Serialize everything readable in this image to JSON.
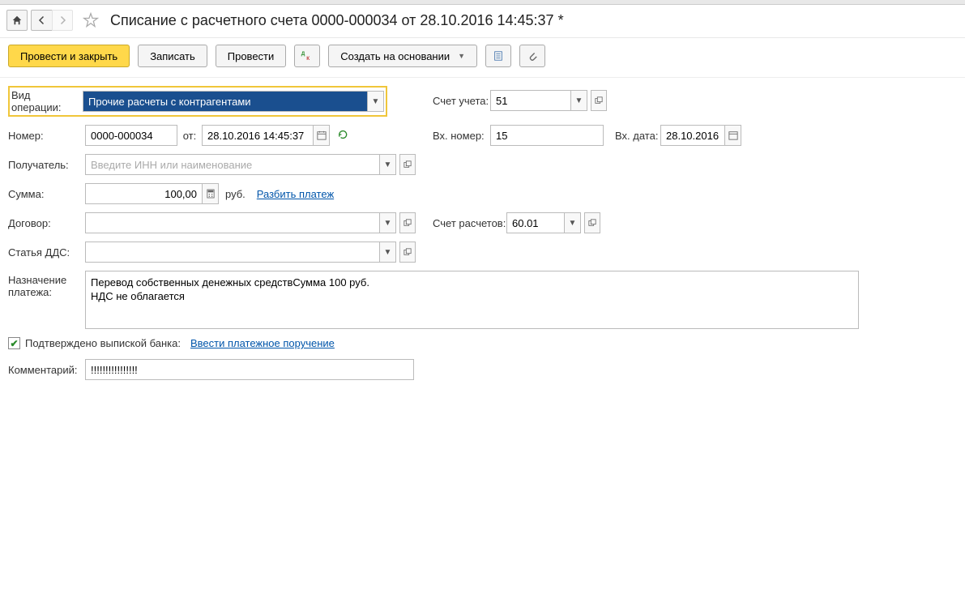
{
  "header": {
    "title": "Списание с расчетного счета 0000-000034 от 28.10.2016 14:45:37 *"
  },
  "toolbar": {
    "post_and_close": "Провести и закрыть",
    "save": "Записать",
    "post": "Провести",
    "create_based_on": "Создать на основании"
  },
  "labels": {
    "operation_type": "Вид операции:",
    "account": "Счет учета:",
    "number": "Номер:",
    "from": "от:",
    "incoming_number": "Вх. номер:",
    "incoming_date": "Вх. дата:",
    "recipient": "Получатель:",
    "amount": "Сумма:",
    "currency": "руб.",
    "split_payment": "Разбить платеж",
    "contract": "Договор:",
    "settlement_account": "Счет расчетов:",
    "dds_article": "Статья ДДС:",
    "purpose": "Назначение\nплатежа:",
    "confirmed": "Подтверждено выпиской банка:",
    "enter_payment_order": "Ввести платежное поручение",
    "comment": "Комментарий:"
  },
  "fields": {
    "operation_type": "Прочие расчеты с контрагентами",
    "account": "51",
    "number": "0000-000034",
    "date": "28.10.2016 14:45:37",
    "incoming_number": "15",
    "incoming_date": "28.10.2016",
    "recipient": "",
    "recipient_placeholder": "Введите ИНН или наименование",
    "amount": "100,00",
    "contract": "",
    "settlement_account": "60.01",
    "dds_article": "",
    "purpose": "Перевод собственных денежных средствСумма 100 руб.\nНДС не облагается",
    "confirmed": true,
    "comment": "!!!!!!!!!!!!!!!!"
  }
}
